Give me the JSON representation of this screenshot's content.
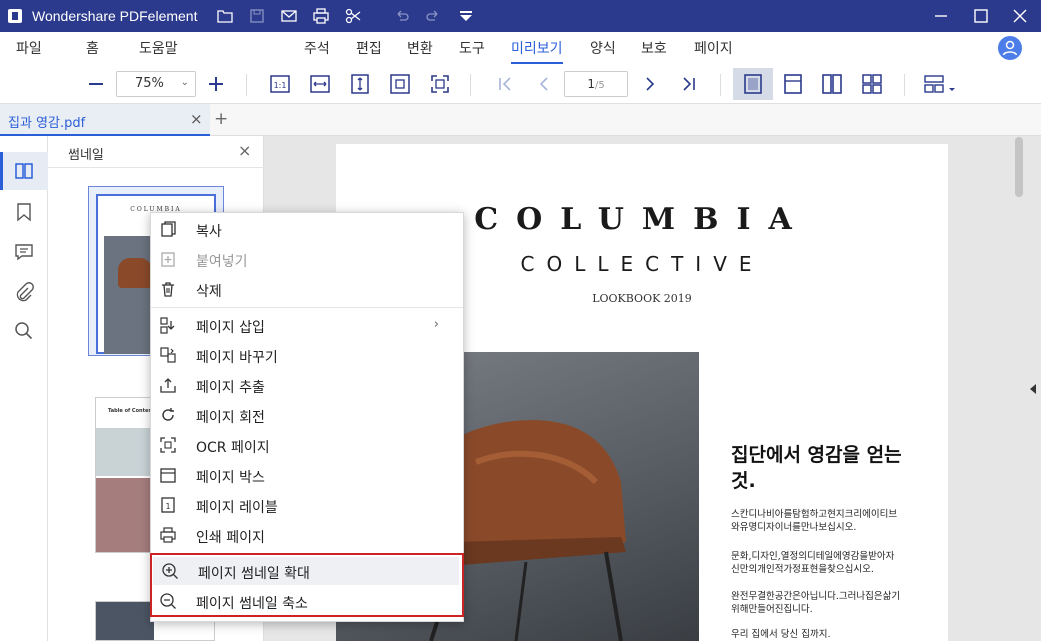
{
  "app": {
    "title": "Wondershare PDFelement"
  },
  "menu": {
    "left": [
      "파일",
      "홈",
      "도움말"
    ],
    "right": [
      "주석",
      "편집",
      "변환",
      "도구",
      "미리보기",
      "양식",
      "보호",
      "페이지"
    ],
    "active": "미리보기"
  },
  "toolbar": {
    "zoom": "75%",
    "page_current": "1",
    "page_total": "/5"
  },
  "tab": {
    "filename": "집과 영감.pdf",
    "close": "×",
    "add": "+"
  },
  "thumbpanel": {
    "title": "썸네일",
    "close": "×"
  },
  "context_menu": {
    "items": [
      {
        "label": "복사",
        "icon": "copy-icon",
        "disabled": false
      },
      {
        "label": "붙여넣기",
        "icon": "paste-icon",
        "disabled": true
      },
      {
        "label": "삭제",
        "icon": "trash-icon",
        "disabled": false
      },
      {
        "label": "페이지 삽입",
        "icon": "insert-page-icon",
        "disabled": false,
        "submenu": "›"
      },
      {
        "label": "페이지 바꾸기",
        "icon": "replace-page-icon",
        "disabled": false
      },
      {
        "label": "페이지 추출",
        "icon": "extract-page-icon",
        "disabled": false
      },
      {
        "label": "페이지 회전",
        "icon": "rotate-icon",
        "disabled": false
      },
      {
        "label": "OCR 페이지",
        "icon": "ocr-icon",
        "disabled": false
      },
      {
        "label": "페이지 박스",
        "icon": "page-box-icon",
        "disabled": false
      },
      {
        "label": "페이지 레이블",
        "icon": "page-label-icon",
        "disabled": false
      },
      {
        "label": "인쇄 페이지",
        "icon": "print-icon",
        "disabled": false
      },
      {
        "label": "페이지 썸네일 확대",
        "icon": "zoom-in-icon",
        "disabled": false
      },
      {
        "label": "페이지 썸네일 축소",
        "icon": "zoom-out-icon",
        "disabled": false
      }
    ]
  },
  "document": {
    "brand": "COLUMBIA",
    "subtitle": "COLLECTIVE",
    "lookbook": "LOOKBOOK 2019",
    "headline": "집단에서 영감을 얻는것.",
    "para1": "스칸디나비아를탐험하고현지크리에이티브와유명디자이너를만나보십시오.",
    "para2": "문화,디자인,열정의디테일에영감을받아자신만의개인적가정표현을찾으십시오.",
    "para3": "완전무결한공간은아닙니다.그러나집은삶기위해만들어진집니다.",
    "para4": "우리 집에서 당신 집까지.",
    "thumb2_title": "Table of Conter"
  },
  "colors": {
    "titlebar": "#2b3a8c",
    "accent": "#2b5fd9",
    "highlight": "#cc2424",
    "chair": "#8a4a2a"
  }
}
